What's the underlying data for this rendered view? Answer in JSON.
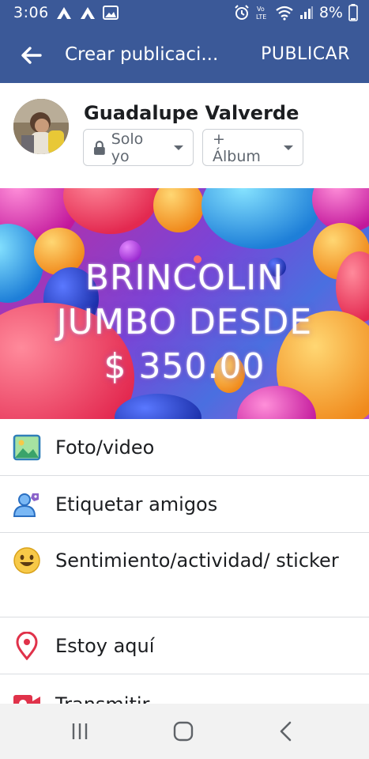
{
  "status_bar": {
    "time": "3:06",
    "battery": "8%",
    "left_icons": [
      "app-notification-icon",
      "app-notification-icon",
      "gallery-icon"
    ],
    "right_icons": [
      "alarm-icon",
      "volte-icon",
      "wifi-icon",
      "signal-icon",
      "battery-icon"
    ],
    "volte_label": "Vo LTE"
  },
  "app_bar": {
    "title": "Crear publicaci...",
    "publish_label": "PUBLICAR",
    "background": "#3b5998"
  },
  "composer": {
    "user_name": "Guadalupe Valverde",
    "privacy_label": "Solo yo",
    "album_label": "+ Álbum"
  },
  "banner": {
    "line1": "BRINCOLIN",
    "line2": "JUMBO DESDE",
    "line3": "$ 350.00"
  },
  "options": [
    {
      "label": "Foto/video",
      "icon": "photo-icon"
    },
    {
      "label": "Etiquetar amigos",
      "icon": "tag-friends-icon"
    },
    {
      "label": "Sentimiento/actividad/ sticker",
      "icon": "smiley-icon"
    },
    {
      "label": "Estoy aquí",
      "icon": "location-pin-icon"
    },
    {
      "label": "Transmitir",
      "icon": "live-video-icon"
    }
  ],
  "nav_bar": {
    "icons": [
      "recents-icon",
      "home-icon",
      "back-icon"
    ]
  }
}
